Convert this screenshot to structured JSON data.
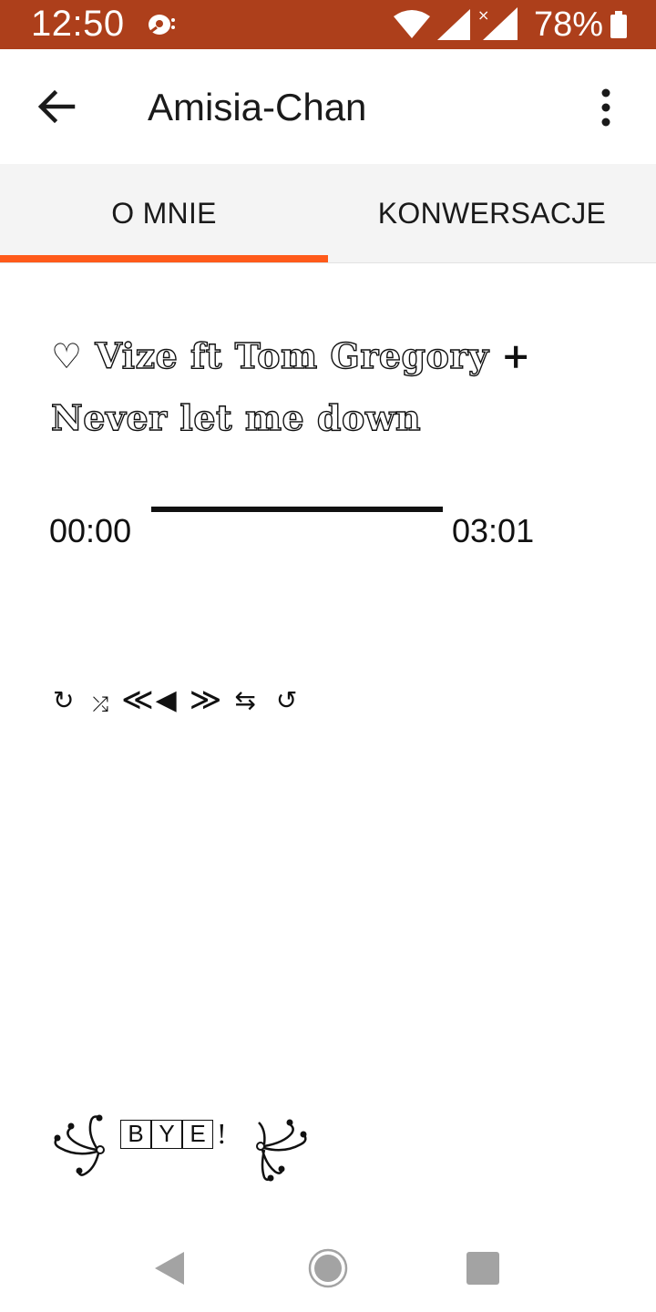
{
  "status_bar": {
    "time": "12:50",
    "battery_percent": "78%",
    "icons": [
      "app-notification-icon",
      "wifi-icon",
      "signal-icon",
      "signal-no-data-icon",
      "battery-icon"
    ],
    "background_color": "#ad3f1b"
  },
  "app_bar": {
    "title": "Amisia-Chan",
    "icons": [
      "arrow-back-icon",
      "more-vert-icon"
    ]
  },
  "tabs": {
    "items": [
      {
        "label": "O MNIE",
        "selected": true
      },
      {
        "label": "KONWERSACJE",
        "selected": false
      }
    ],
    "indicator_color": "#ff5a1a"
  },
  "song": {
    "heart": "♡",
    "line1": "Vize ft Tom Gregory",
    "plus": "+",
    "line2": "Never let me down"
  },
  "player": {
    "time_start": "00:00",
    "time_end": "03:01",
    "progress_fraction": 1.0,
    "controls": {
      "repeat": "↻",
      "shuffle": "⤮",
      "prev": "≪",
      "play": "◀",
      "next": "≫",
      "swap": "⇆",
      "replay": "↺"
    }
  },
  "bye": {
    "letters": [
      "B",
      "Y",
      "E"
    ],
    "exclamation": "!"
  },
  "nav_bar": {
    "icons": [
      "nav-back-icon",
      "nav-home-icon",
      "nav-recent-icon"
    ]
  }
}
